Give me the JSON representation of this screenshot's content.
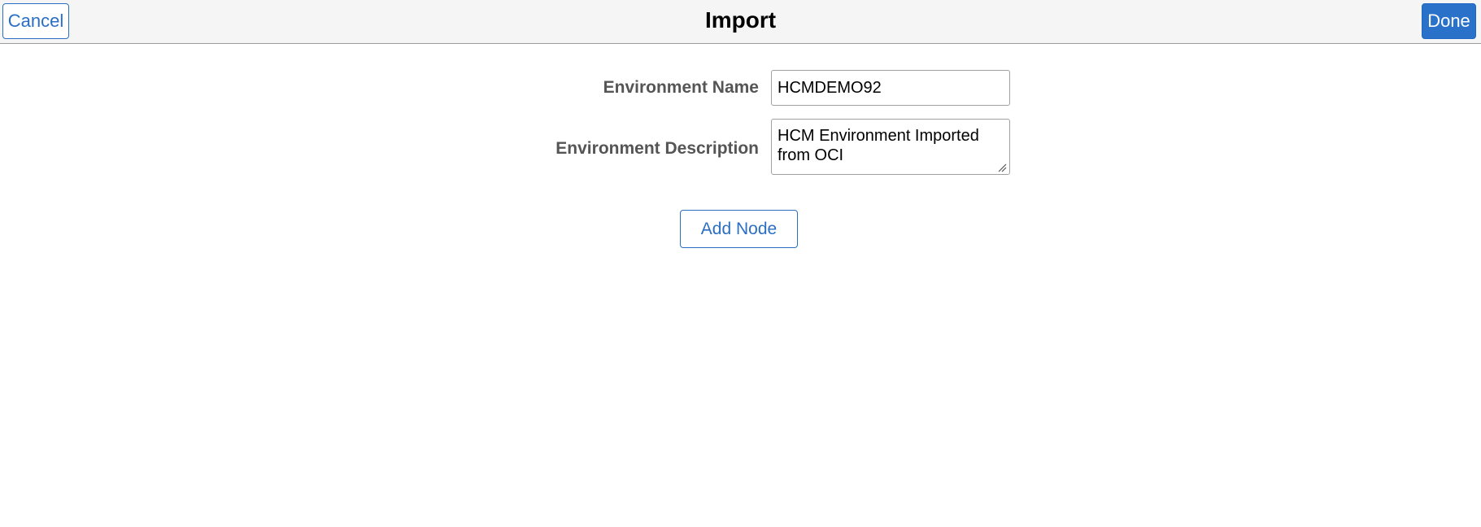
{
  "header": {
    "title": "Import",
    "cancel_label": "Cancel",
    "done_label": "Done"
  },
  "form": {
    "environment_name": {
      "label": "Environment Name",
      "value": "HCMDEMO92"
    },
    "environment_description": {
      "label": "Environment Description",
      "value": "HCM Environment Imported from OCI"
    }
  },
  "actions": {
    "add_node_label": "Add Node"
  },
  "icons": {
    "textarea_resize": "resize-grip-icon"
  },
  "colors": {
    "accent": "#2a6fc3",
    "primary_button_bg": "#2a72c9",
    "header_bg": "#f5f5f5",
    "label_text": "#555555"
  }
}
